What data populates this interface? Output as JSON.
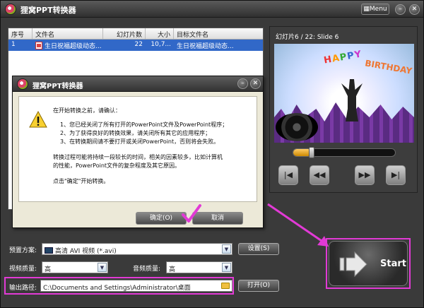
{
  "window": {
    "title": "狸窝PPT转换器",
    "menu_label": "Menu",
    "controls": [
      "–",
      "✕"
    ]
  },
  "file_list": {
    "columns": [
      "序号",
      "文件名",
      "幻灯片数",
      "大小",
      "目标文件名"
    ],
    "rows": [
      {
        "index": "1",
        "name": "生日祝福超级动态...",
        "slides": "22",
        "size": "10,7...",
        "target": "生日祝福超级动态..."
      }
    ]
  },
  "preview": {
    "slide_label": "幻灯片6 / 22: Slide 6",
    "slide_text_happy": "HAPPY",
    "slide_text_birthday": "BIRTHDAY",
    "progress_fraction": 0.18,
    "buttons": [
      "|◀",
      "◀◀",
      "▶▶",
      "▶|"
    ]
  },
  "settings": {
    "preset_label": "预置方案:",
    "preset_value": "高清 AVI 视频 (*.avi)",
    "settings_button": "设置(S)",
    "video_quality_label": "视频质量:",
    "video_quality_value": "高",
    "audio_quality_label": "音频质量:",
    "audio_quality_value": "高",
    "output_label": "输出路径:",
    "output_value": "C:\\Documents and Settings\\Administrator\\桌面",
    "open_button": "打开(O)"
  },
  "start": {
    "label": "Start"
  },
  "dialog": {
    "title": "狸窝PPT转换器",
    "lines": [
      "在开始转换之前，请确认：",
      "1、您已经关闭了所有打开的PowerPoint文件及PowerPoint程序；",
      "2、为了获得良好的转换效果，请关闭所有其它的应用程序；",
      "3、在转换期间请不要打开或关闭PowerPoint，否则将会失败。",
      "转换过程可能将持续一段较长的时间，相关的因素较多，比如计算机",
      "的性能，PowerPoint文件的复杂程度及其它原因。",
      "点击\"确定\"开始转换。"
    ],
    "ok_button": "确定(O)",
    "cancel_button": "取消"
  },
  "colors": {
    "highlight": "#e23ad6",
    "selection": "#3168c8"
  }
}
